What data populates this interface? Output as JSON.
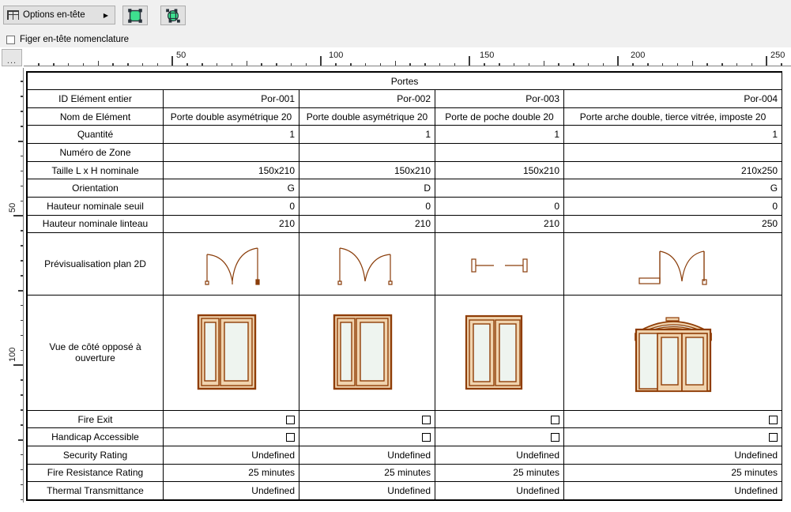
{
  "toolbar": {
    "header_options_label": "Options en-tête",
    "header_options_arrow": "▶",
    "table_icon": "table-icon",
    "view_2d_icon": "2d-view-icon",
    "view_3d_icon": "3d-view-icon",
    "accent_green": "#3ee08f",
    "icon_dark": "#27323a"
  },
  "freeze": {
    "label": "Figer en-tête nomenclature",
    "checked": false
  },
  "corner": {
    "label": "..."
  },
  "rulers": {
    "horizontal": {
      "labels": [
        "50",
        "100",
        "150",
        "200",
        "250"
      ],
      "positions": [
        218,
        411,
        602,
        793,
        970
      ]
    },
    "vertical": {
      "labels": [
        "50",
        "100"
      ],
      "positions": [
        273,
        462
      ]
    }
  },
  "schedule": {
    "title": "Portes",
    "columns": [
      {
        "id": "Por-001"
      },
      {
        "id": "Por-002"
      },
      {
        "id": "Por-003"
      },
      {
        "id": "Por-004"
      }
    ],
    "rows": [
      {
        "label": "ID Elément entier",
        "align": "right",
        "values": [
          "Por-001",
          "Por-002",
          "Por-003",
          "Por-004"
        ]
      },
      {
        "label": "Nom de Elément",
        "align": "center",
        "values": [
          "Porte double asymétrique 20",
          "Porte double asymétrique 20",
          "Porte de poche double 20",
          "Porte arche double, tierce vitrée, imposte 20"
        ]
      },
      {
        "label": "Quantité",
        "align": "right",
        "values": [
          "1",
          "1",
          "1",
          "1"
        ]
      },
      {
        "label": "Numéro de Zone",
        "align": "right",
        "values": [
          "",
          "",
          "",
          ""
        ]
      },
      {
        "label": "Taille L x H nominale",
        "align": "right",
        "values": [
          "150x210",
          "150x210",
          "150x210",
          "210x250"
        ]
      },
      {
        "label": "Orientation",
        "align": "right",
        "values": [
          "G",
          "D",
          "",
          "G"
        ]
      },
      {
        "label": "Hauteur nominale seuil",
        "align": "right",
        "values": [
          "0",
          "0",
          "0",
          "0"
        ]
      },
      {
        "label": "Hauteur nominale linteau",
        "align": "right",
        "values": [
          "210",
          "210",
          "210",
          "250"
        ]
      }
    ],
    "graphic_rows": [
      {
        "label": "Prévisualisation plan 2D",
        "kind": "plan2d"
      },
      {
        "label": "Vue de côté opposé à ouverture",
        "kind": "elevation"
      }
    ],
    "footer_rows": [
      {
        "label": "Fire Exit",
        "kind": "checkbox",
        "align": "right",
        "values": [
          "",
          "",
          "",
          ""
        ]
      },
      {
        "label": "Handicap Accessible",
        "kind": "checkbox",
        "align": "right",
        "values": [
          "",
          "",
          "",
          ""
        ]
      },
      {
        "label": "Security Rating",
        "kind": "text",
        "align": "right",
        "values": [
          "Undefined",
          "Undefined",
          "Undefined",
          "Undefined"
        ]
      },
      {
        "label": "Fire Resistance Rating",
        "kind": "text",
        "align": "right",
        "values": [
          "25 minutes",
          "25 minutes",
          "25 minutes",
          "25 minutes"
        ]
      },
      {
        "label": "Thermal Transmittance",
        "kind": "text",
        "align": "right",
        "values": [
          "Undefined",
          "Undefined",
          "Undefined",
          "Undefined"
        ]
      }
    ],
    "symbol_colors": {
      "plan_stroke": "#8a3d0a",
      "door_outline": "#8f3d06",
      "door_frame_fill": "#f0d3ae",
      "door_glass_fill": "#eef4ef"
    }
  }
}
